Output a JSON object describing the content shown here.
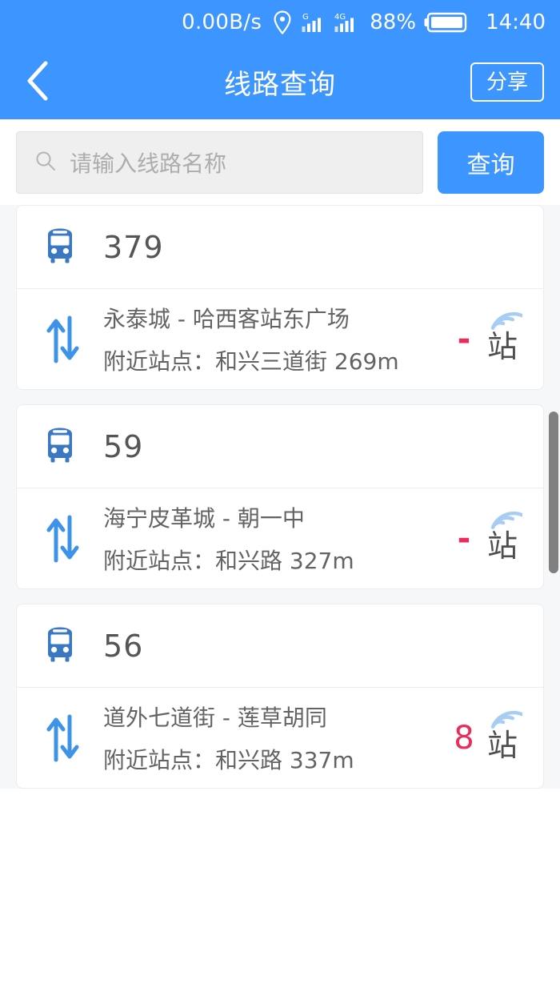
{
  "status_bar": {
    "network_speed": "0.00B/s",
    "location_icon": "location-pin-icon",
    "signal_1_label": "G",
    "signal_2_label": "4G",
    "battery_percent": "88%",
    "battery_icon": "battery-icon",
    "time": "14:40"
  },
  "header": {
    "back_icon": "chevron-left-icon",
    "title": "线路查询",
    "share_label": "分享"
  },
  "search": {
    "icon": "search-icon",
    "placeholder": "请输入线路名称",
    "value": "",
    "button_label": "查询"
  },
  "colors": {
    "brand_blue": "#3d95ff",
    "icon_blue": "#3b78c4",
    "arrow_blue": "#3d93e8",
    "accent_pink": "#ec2b5b",
    "signal_blue": "#a8cdf2",
    "text_gray": "#636363",
    "page_bg": "#f6f7f9"
  },
  "results": [
    {
      "bus_icon": "bus-icon",
      "route_number": "379",
      "swap_icon": "swap-vertical-icon",
      "route_name": "永泰城 - 哈西客站东广场",
      "nearby_stop": "附近站点：和兴三道街 269m",
      "stops_count": "-",
      "stops_unit": "站",
      "signal_icon": "signal-arc-icon"
    },
    {
      "bus_icon": "bus-icon",
      "route_number": "59",
      "swap_icon": "swap-vertical-icon",
      "route_name": "海宁皮革城 - 朝一中",
      "nearby_stop": "附近站点：和兴路 327m",
      "stops_count": "-",
      "stops_unit": "站",
      "signal_icon": "signal-arc-icon"
    },
    {
      "bus_icon": "bus-icon",
      "route_number": "56",
      "swap_icon": "swap-vertical-icon",
      "route_name": "道外七道街 - 莲草胡同",
      "nearby_stop": "附近站点：和兴路 337m",
      "stops_count": "8",
      "stops_unit": "站",
      "signal_icon": "signal-arc-icon"
    }
  ]
}
